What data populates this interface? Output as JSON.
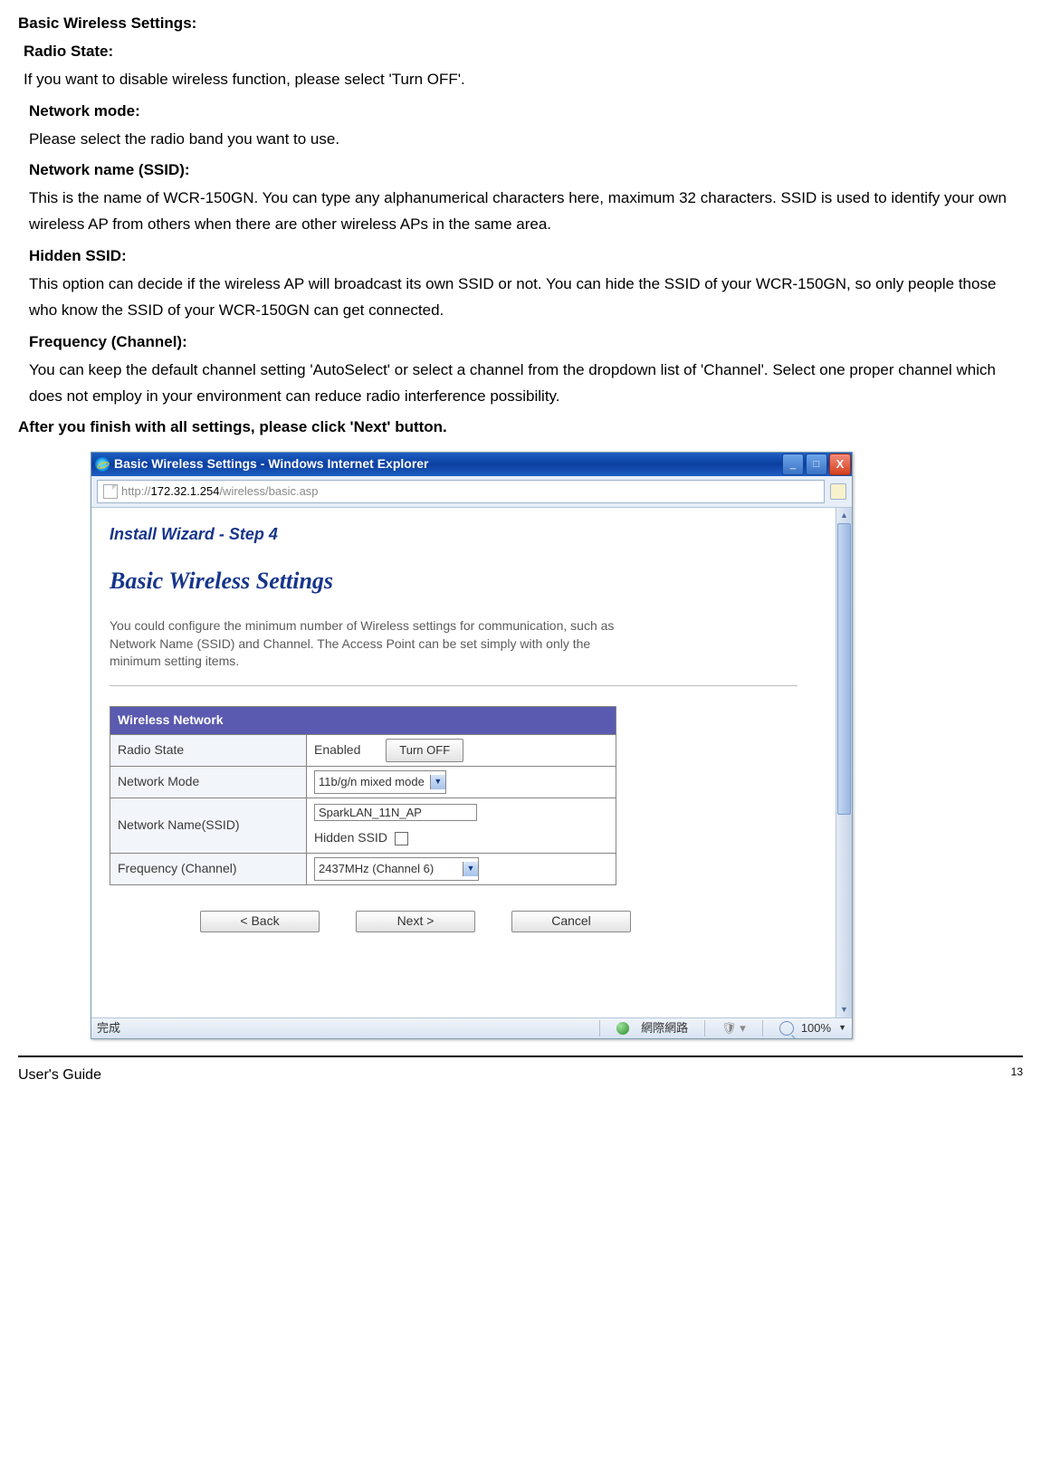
{
  "doc": {
    "h1": "Basic Wireless Settings:",
    "radio_h": "Radio State:",
    "radio_t": "If you want to disable wireless function, please select 'Turn OFF'.",
    "mode_h": "Network mode:",
    "mode_t": "Please select the radio band you want to use.",
    "ssid_h": "Network name (SSID):",
    "ssid_t": "This is the name of WCR-150GN. You can type any alphanumerical characters here, maximum 32 characters. SSID is used to identify your own wireless AP from others when there are other wireless APs in the same area.",
    "hidden_h": "Hidden SSID:",
    "hidden_t": "This option can decide if the wireless AP will broadcast its own SSID or not. You can hide the SSID of your WCR-150GN, so only people those who know the SSID of your WCR-150GN can get connected.",
    "freq_h": "Frequency (Channel):",
    "freq_t": "You can keep the default channel setting 'AutoSelect' or select a channel from the dropdown list of 'Channel'. Select one proper channel which does not employ in your environment can reduce radio interference possibility.",
    "after": "After you finish with all settings, please click 'Next' button."
  },
  "ie": {
    "title": "Basic Wireless Settings - Windows Internet Explorer",
    "url_prefix": "http://",
    "url_host": "172.32.1.254",
    "url_path": "/wireless/basic.asp",
    "status_done": "完成",
    "status_zone": "網際網路",
    "zoom": "100%"
  },
  "wizard": {
    "step": "Install Wizard - Step 4",
    "title": "Basic Wireless Settings",
    "desc": "You could configure the minimum number of Wireless settings for communication, such as Network Name (SSID) and Channel. The Access Point can be set simply with only the minimum setting items.",
    "section": "Wireless Network",
    "rows": {
      "radio": {
        "label": "Radio State",
        "value": "Enabled",
        "button": "Turn OFF"
      },
      "mode": {
        "label": "Network Mode",
        "value": "11b/g/n mixed mode"
      },
      "ssid": {
        "label": "Network Name(SSID)",
        "value": "SparkLAN_11N_AP",
        "hidden_label": "Hidden SSID"
      },
      "freq": {
        "label": "Frequency (Channel)",
        "value": "2437MHz (Channel 6)"
      }
    },
    "buttons": {
      "back": "< Back",
      "next": "Next >",
      "cancel": "Cancel"
    }
  },
  "footer": {
    "guide": "User's Guide",
    "page": "13"
  }
}
